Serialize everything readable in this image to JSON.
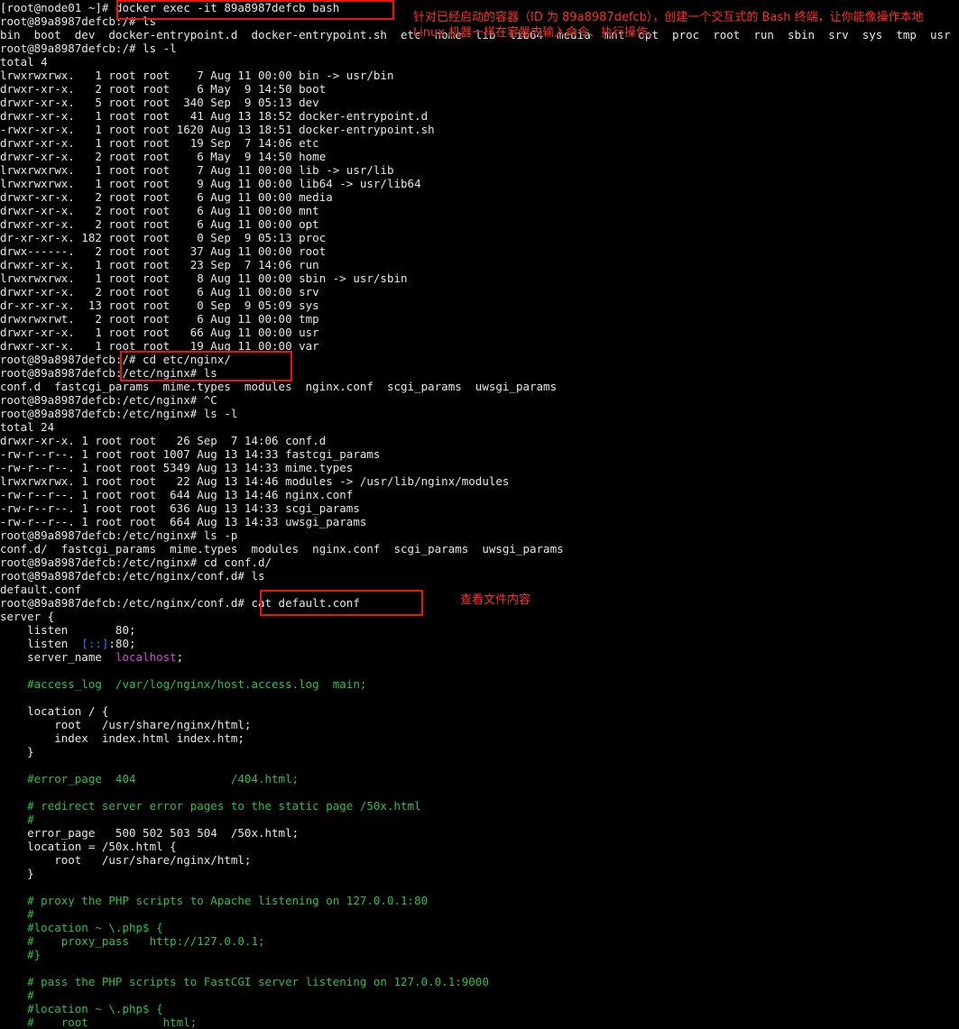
{
  "lines": [
    {
      "segments": [
        {
          "text": "[root@node01 ~]# docker exec -it 89a8987defcb bash"
        }
      ]
    },
    {
      "segments": [
        {
          "text": "root@89a8987defcb:/# ls"
        }
      ]
    },
    {
      "segments": [
        {
          "text": "bin  boot  dev  docker-entrypoint.d  docker-entrypoint.sh  etc  home  lib  lib64  media  mnt  opt  proc  root  run  sbin  srv  sys  tmp  usr  var"
        }
      ]
    },
    {
      "segments": [
        {
          "text": "root@89a8987defcb:/# ls -l"
        }
      ]
    },
    {
      "segments": [
        {
          "text": "total 4"
        }
      ]
    },
    {
      "segments": [
        {
          "text": "lrwxrwxrwx.   1 root root    7 Aug 11 00:00 bin -> usr/bin"
        }
      ]
    },
    {
      "segments": [
        {
          "text": "drwxr-xr-x.   2 root root    6 May  9 14:50 boot"
        }
      ]
    },
    {
      "segments": [
        {
          "text": "drwxr-xr-x.   5 root root  340 Sep  9 05:13 dev"
        }
      ]
    },
    {
      "segments": [
        {
          "text": "drwxr-xr-x.   1 root root   41 Aug 13 18:52 docker-entrypoint.d"
        }
      ]
    },
    {
      "segments": [
        {
          "text": "-rwxr-xr-x.   1 root root 1620 Aug 13 18:51 docker-entrypoint.sh"
        }
      ]
    },
    {
      "segments": [
        {
          "text": "drwxr-xr-x.   1 root root   19 Sep  7 14:06 etc"
        }
      ]
    },
    {
      "segments": [
        {
          "text": "drwxr-xr-x.   2 root root    6 May  9 14:50 home"
        }
      ]
    },
    {
      "segments": [
        {
          "text": "lrwxrwxrwx.   1 root root    7 Aug 11 00:00 lib -> usr/lib"
        }
      ]
    },
    {
      "segments": [
        {
          "text": "lrwxrwxrwx.   1 root root    9 Aug 11 00:00 lib64 -> usr/lib64"
        }
      ]
    },
    {
      "segments": [
        {
          "text": "drwxr-xr-x.   2 root root    6 Aug 11 00:00 media"
        }
      ]
    },
    {
      "segments": [
        {
          "text": "drwxr-xr-x.   2 root root    6 Aug 11 00:00 mnt"
        }
      ]
    },
    {
      "segments": [
        {
          "text": "drwxr-xr-x.   2 root root    6 Aug 11 00:00 opt"
        }
      ]
    },
    {
      "segments": [
        {
          "text": "dr-xr-xr-x. 182 root root    0 Sep  9 05:13 proc"
        }
      ]
    },
    {
      "segments": [
        {
          "text": "drwx------.   2 root root   37 Aug 11 00:00 root"
        }
      ]
    },
    {
      "segments": [
        {
          "text": "drwxr-xr-x.   1 root root   23 Sep  7 14:06 run"
        }
      ]
    },
    {
      "segments": [
        {
          "text": "lrwxrwxrwx.   1 root root    8 Aug 11 00:00 sbin -> usr/sbin"
        }
      ]
    },
    {
      "segments": [
        {
          "text": "drwxr-xr-x.   2 root root    6 Aug 11 00:00 srv"
        }
      ]
    },
    {
      "segments": [
        {
          "text": "dr-xr-xr-x.  13 root root    0 Sep  9 05:09 sys"
        }
      ]
    },
    {
      "segments": [
        {
          "text": "drwxrwxrwt.   2 root root    6 Aug 11 00:00 tmp"
        }
      ]
    },
    {
      "segments": [
        {
          "text": "drwxr-xr-x.   1 root root   66 Aug 11 00:00 usr"
        }
      ]
    },
    {
      "segments": [
        {
          "text": "drwxr-xr-x.   1 root root   19 Aug 11 00:00 var"
        }
      ]
    },
    {
      "segments": [
        {
          "text": "root@89a8987defcb:/# cd etc/nginx/"
        }
      ]
    },
    {
      "segments": [
        {
          "text": "root@89a8987defcb:/etc/nginx# ls"
        }
      ]
    },
    {
      "segments": [
        {
          "text": "conf.d  fastcgi_params  mime.types  modules  nginx.conf  scgi_params  uwsgi_params"
        }
      ]
    },
    {
      "segments": [
        {
          "text": "root@89a8987defcb:/etc/nginx# ^C"
        }
      ]
    },
    {
      "segments": [
        {
          "text": "root@89a8987defcb:/etc/nginx# ls -l"
        }
      ]
    },
    {
      "segments": [
        {
          "text": "total 24"
        }
      ]
    },
    {
      "segments": [
        {
          "text": "drwxr-xr-x. 1 root root   26 Sep  7 14:06 conf.d"
        }
      ]
    },
    {
      "segments": [
        {
          "text": "-rw-r--r--. 1 root root 1007 Aug 13 14:33 fastcgi_params"
        }
      ]
    },
    {
      "segments": [
        {
          "text": "-rw-r--r--. 1 root root 5349 Aug 13 14:33 mime.types"
        }
      ]
    },
    {
      "segments": [
        {
          "text": "lrwxrwxrwx. 1 root root   22 Aug 13 14:46 modules -> /usr/lib/nginx/modules"
        }
      ]
    },
    {
      "segments": [
        {
          "text": "-rw-r--r--. 1 root root  644 Aug 13 14:46 nginx.conf"
        }
      ]
    },
    {
      "segments": [
        {
          "text": "-rw-r--r--. 1 root root  636 Aug 13 14:33 scgi_params"
        }
      ]
    },
    {
      "segments": [
        {
          "text": "-rw-r--r--. 1 root root  664 Aug 13 14:33 uwsgi_params"
        }
      ]
    },
    {
      "segments": [
        {
          "text": "root@89a8987defcb:/etc/nginx# ls -p"
        }
      ]
    },
    {
      "segments": [
        {
          "text": "conf.d/  fastcgi_params  mime.types  modules  nginx.conf  scgi_params  uwsgi_params"
        }
      ]
    },
    {
      "segments": [
        {
          "text": "root@89a8987defcb:/etc/nginx# cd conf.d/"
        }
      ]
    },
    {
      "segments": [
        {
          "text": "root@89a8987defcb:/etc/nginx/conf.d# ls"
        }
      ]
    },
    {
      "segments": [
        {
          "text": "default.conf"
        }
      ]
    },
    {
      "segments": [
        {
          "text": "root@89a8987defcb:/etc/nginx/conf.d# cat default.conf"
        }
      ]
    },
    {
      "segments": [
        {
          "text": "server {"
        }
      ]
    },
    {
      "segments": [
        {
          "text": "    listen       80;"
        }
      ]
    },
    {
      "segments": [
        {
          "text": "    listen  "
        },
        {
          "text": "[::]",
          "color": "blue"
        },
        {
          "text": ":80;"
        }
      ]
    },
    {
      "segments": [
        {
          "text": "    server_name  "
        },
        {
          "text": "localhost",
          "color": "magenta"
        },
        {
          "text": ";"
        }
      ]
    },
    {
      "segments": [
        {
          "text": ""
        }
      ]
    },
    {
      "segments": [
        {
          "text": "    #access_log  /var/log/nginx/host.access.log  main;",
          "color": "green"
        }
      ]
    },
    {
      "segments": [
        {
          "text": ""
        }
      ]
    },
    {
      "segments": [
        {
          "text": "    location / {"
        }
      ]
    },
    {
      "segments": [
        {
          "text": "        root   /usr/share/nginx/html;"
        }
      ]
    },
    {
      "segments": [
        {
          "text": "        index  index.html index.htm;"
        }
      ]
    },
    {
      "segments": [
        {
          "text": "    }"
        }
      ]
    },
    {
      "segments": [
        {
          "text": ""
        }
      ]
    },
    {
      "segments": [
        {
          "text": "    #error_page  404              /404.html;",
          "color": "green"
        }
      ]
    },
    {
      "segments": [
        {
          "text": ""
        }
      ]
    },
    {
      "segments": [
        {
          "text": "    # redirect server error pages to the static page /50x.html",
          "color": "green"
        }
      ]
    },
    {
      "segments": [
        {
          "text": "    #",
          "color": "green"
        }
      ]
    },
    {
      "segments": [
        {
          "text": "    error_page   500 502 503 504  /50x.html;"
        }
      ]
    },
    {
      "segments": [
        {
          "text": "    location = /50x.html {"
        }
      ]
    },
    {
      "segments": [
        {
          "text": "        root   /usr/share/nginx/html;"
        }
      ]
    },
    {
      "segments": [
        {
          "text": "    }"
        }
      ]
    },
    {
      "segments": [
        {
          "text": ""
        }
      ]
    },
    {
      "segments": [
        {
          "text": "    # proxy the PHP scripts to Apache listening on 127.0.0.1:80",
          "color": "green"
        }
      ]
    },
    {
      "segments": [
        {
          "text": "    #",
          "color": "green"
        }
      ]
    },
    {
      "segments": [
        {
          "text": "    #location ~ \\.php$ {",
          "color": "green"
        }
      ]
    },
    {
      "segments": [
        {
          "text": "    #    proxy_pass   http://127.0.0.1;",
          "color": "green"
        }
      ]
    },
    {
      "segments": [
        {
          "text": "    #}",
          "color": "green"
        }
      ]
    },
    {
      "segments": [
        {
          "text": ""
        }
      ]
    },
    {
      "segments": [
        {
          "text": "    # pass the PHP scripts to FastCGI server listening on 127.0.0.1:9000",
          "color": "green"
        }
      ]
    },
    {
      "segments": [
        {
          "text": "    #",
          "color": "green"
        }
      ]
    },
    {
      "segments": [
        {
          "text": "    #location ~ \\.php$ {",
          "color": "green"
        }
      ]
    },
    {
      "segments": [
        {
          "text": "    #    root           html;",
          "color": "green"
        }
      ]
    }
  ],
  "annotations": {
    "note_1": "针对已经启动的容器（ID 为 89a8987defcb），创建一个交互式的 Bash 终端，让你能像操作本地 Linux 机器一样在容器内输入命令、执行操作。",
    "note_2": "查看文件内容"
  },
  "colors": {
    "background": "#000000",
    "text": "#e6e6e6",
    "green": "#2fbf4a",
    "blue": "#3a76ff",
    "magenta": "#d04ad6",
    "annotation": "#ff2d2d"
  }
}
